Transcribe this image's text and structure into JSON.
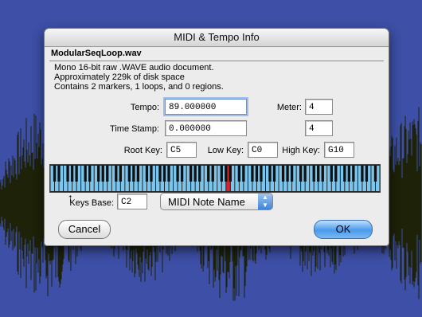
{
  "window": {
    "title": "MIDI & Tempo Info"
  },
  "file": {
    "name": "ModularSeqLoop.wav",
    "description": [
      "Mono 16-bit raw  .WAVE audio document.",
      "Approximately 229k of disk space",
      "Contains 2 markers, 1 loops, and 0 regions."
    ]
  },
  "form": {
    "tempo_label": "Tempo:",
    "tempo_value": "89.000000",
    "timestamp_label": "Time Stamp:",
    "timestamp_value": "0.000000",
    "meter_label": "Meter:",
    "meter_top": "4",
    "meter_bottom": "4",
    "root_key_label": "Root Key:",
    "root_key_value": "C5",
    "low_key_label": "Low Key:",
    "low_key_value": "C0",
    "high_key_label": "High Key:",
    "high_key_value": "G10",
    "keys_base_label": "Keys Base:",
    "keys_base_value": "C2",
    "midi_note_select": "MIDI Note Name"
  },
  "keyboard": {
    "white_key_color": "#7cc6ee",
    "root_key_color": "#d8232a",
    "root_white_key_index": 40
  },
  "buttons": {
    "cancel": "Cancel",
    "ok": "OK"
  },
  "colors": {
    "desktop": "#3d4fa6",
    "ok_button": "#4a9aeb"
  }
}
